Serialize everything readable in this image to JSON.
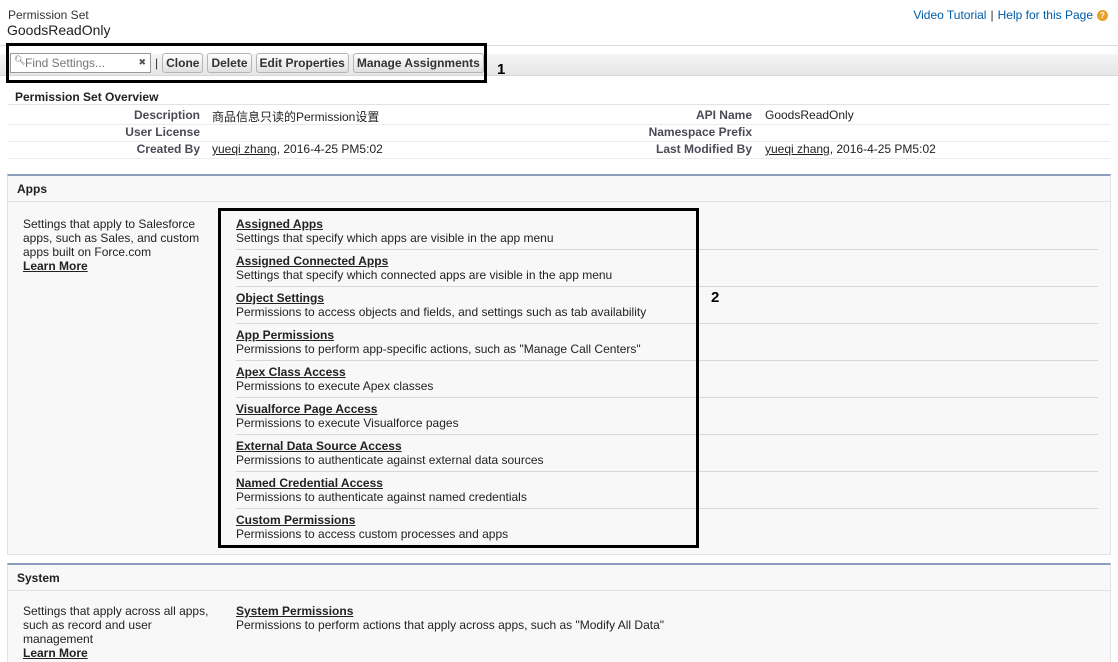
{
  "header": {
    "type_label": "Permission Set",
    "name": "GoodsReadOnly",
    "video_tutorial": "Video Tutorial",
    "separator": "|",
    "help_link": "Help for this Page",
    "help_icon_glyph": "?"
  },
  "toolbar": {
    "search_placeholder": "Find Settings...",
    "separator": "|",
    "clone_label": "Clone",
    "delete_label": "Delete",
    "edit_properties_label": "Edit Properties",
    "manage_assignments_label": "Manage Assignments"
  },
  "annotations": {
    "label_1": "1",
    "label_2": "2"
  },
  "overview": {
    "title": "Permission Set Overview",
    "fields": {
      "description_label": "Description",
      "description_value": "商品信息只读的Permission设置",
      "api_name_label": "API Name",
      "api_name_value": "GoodsReadOnly",
      "user_license_label": "User License",
      "user_license_value": "",
      "namespace_prefix_label": "Namespace Prefix",
      "namespace_prefix_value": "",
      "created_by_label": "Created By",
      "created_by_user": "yueqi zhang",
      "created_by_date": ", 2016-4-25 PM5:02",
      "last_modified_label": "Last Modified By",
      "last_modified_user": "yueqi zhang",
      "last_modified_date": ", 2016-4-25 PM5:02"
    }
  },
  "apps": {
    "title": "Apps",
    "description": "Settings that apply to Salesforce apps, such as Sales, and custom apps built on Force.com",
    "learn_more": "Learn More",
    "items": [
      {
        "title": "Assigned Apps",
        "desc": "Settings that specify which apps are visible in the app menu"
      },
      {
        "title": "Assigned Connected Apps",
        "desc": "Settings that specify which connected apps are visible in the app menu"
      },
      {
        "title": "Object Settings",
        "desc": "Permissions to access objects and fields, and settings such as tab availability"
      },
      {
        "title": "App Permissions",
        "desc": "Permissions to perform app-specific actions, such as \"Manage Call Centers\""
      },
      {
        "title": "Apex Class Access",
        "desc": "Permissions to execute Apex classes"
      },
      {
        "title": "Visualforce Page Access",
        "desc": "Permissions to execute Visualforce pages"
      },
      {
        "title": "External Data Source Access",
        "desc": "Permissions to authenticate against external data sources"
      },
      {
        "title": "Named Credential Access",
        "desc": "Permissions to authenticate against named credentials"
      },
      {
        "title": "Custom Permissions",
        "desc": "Permissions to access custom processes and apps"
      }
    ]
  },
  "system": {
    "title": "System",
    "description": "Settings that apply across all apps, such as record and user management",
    "learn_more": "Learn More",
    "items": [
      {
        "title": "System Permissions",
        "desc": "Permissions to perform actions that apply across apps, such as \"Modify All Data\""
      }
    ]
  }
}
